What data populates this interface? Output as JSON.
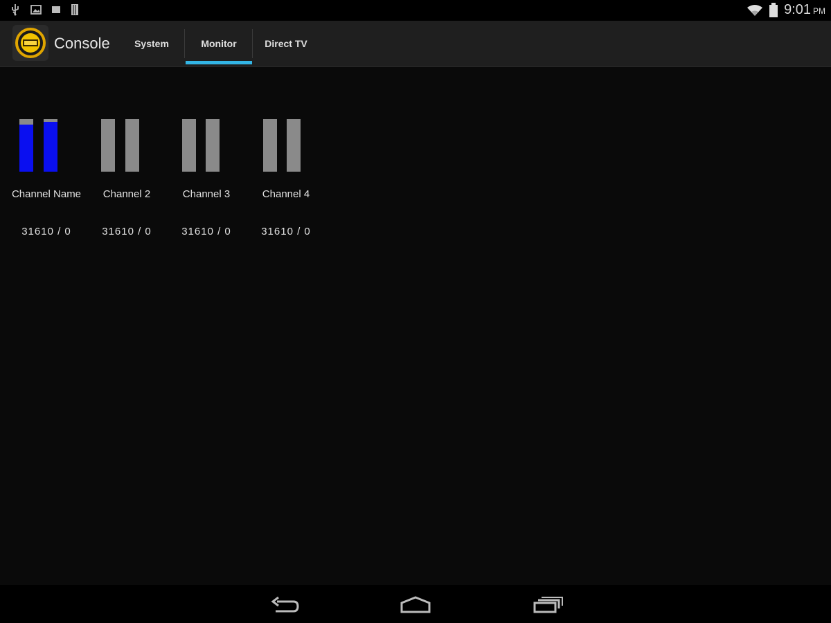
{
  "status_bar": {
    "left_icons": [
      "usb-icon",
      "image-icon",
      "square-notification-icon",
      "sd-card-icon"
    ],
    "wifi_icon": "wifi-icon",
    "battery_icon": "battery-icon",
    "time": "9:01",
    "ampm": "PM"
  },
  "action_bar": {
    "app_title": "Console",
    "tabs": [
      {
        "label": "System",
        "selected": false
      },
      {
        "label": "Monitor",
        "selected": true
      },
      {
        "label": "Direct TV",
        "selected": false
      }
    ],
    "accent_color": "#33b5e5"
  },
  "channels": [
    {
      "name": "Channel Name",
      "value": "31610 / 0",
      "levels": [
        0.9,
        0.95
      ],
      "active": true
    },
    {
      "name": "Channel 2",
      "value": "31610 / 0",
      "levels": [
        0,
        0
      ],
      "active": false
    },
    {
      "name": "Channel 3",
      "value": "31610 / 0",
      "levels": [
        0,
        0
      ],
      "active": false
    },
    {
      "name": "Channel 4",
      "value": "31610 / 0",
      "levels": [
        0,
        0
      ],
      "active": false
    }
  ],
  "colors": {
    "meter_active": "#0a0ff0",
    "meter_idle": "#8a8a8a",
    "background": "#0a0a0a"
  },
  "nav_bar": {
    "buttons": [
      "back-icon",
      "home-icon",
      "recent-apps-icon"
    ]
  }
}
